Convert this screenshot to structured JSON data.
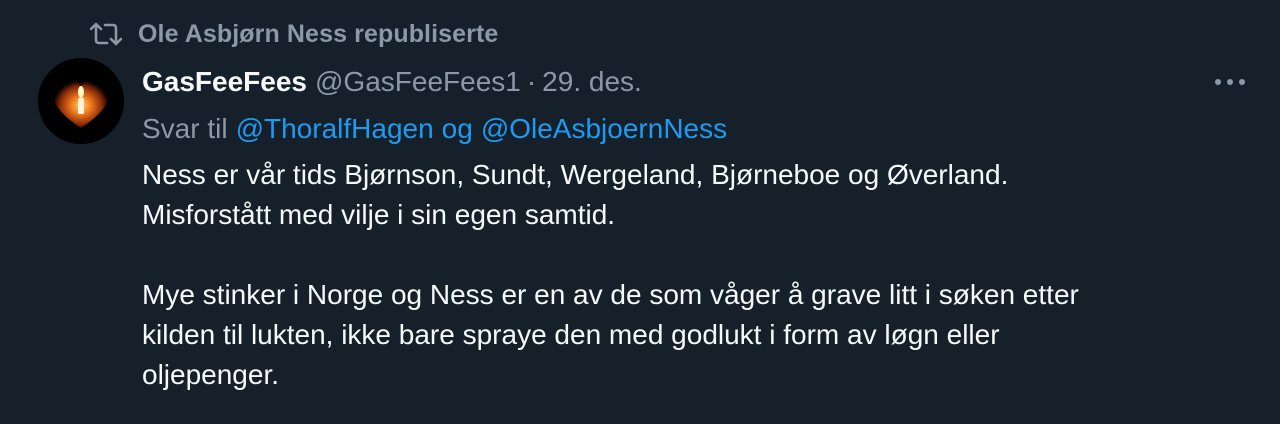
{
  "repost": {
    "icon": "repost-icon",
    "text": "Ole Asbjørn Ness republiserte"
  },
  "tweet": {
    "avatar_icon": "heart-candle-avatar",
    "display_name": "GasFeeFees",
    "handle": "@GasFeeFees1",
    "separator": "·",
    "date": "29. des.",
    "more_icon": "more-icon",
    "reply": {
      "prefix": "Svar til",
      "mention_1": "@ThoralfHagen",
      "joiner": "og",
      "mention_2": "@OleAsbjoernNess"
    },
    "lines": [
      "Ness er vår tids Bjørnson, Sundt, Wergeland, Bjørneboe og Øverland.",
      "Misforstått med vilje i sin egen samtid.",
      "Mye stinker i Norge og Ness er en av de som våger å grave litt i søken etter",
      "kilden til lukten, ikke bare spraye den med godlukt i form av løgn eller",
      "oljepenger."
    ]
  },
  "colors": {
    "background": "#15202b",
    "text_primary": "#f7f9f9",
    "text_secondary": "#8b98a5",
    "link": "#1d9bf0"
  }
}
